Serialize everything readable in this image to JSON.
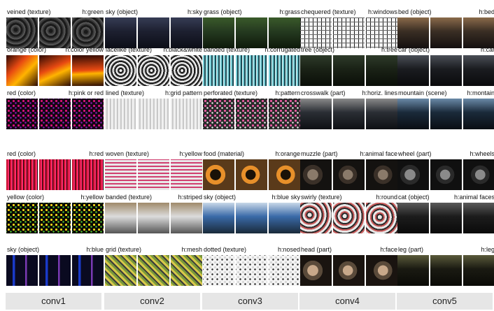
{
  "columns": [
    "conv1",
    "conv2",
    "conv3",
    "conv4",
    "conv5"
  ],
  "cells": [
    [
      {
        "concept": "veined (texture)",
        "hint": "h:green",
        "palette": [
          "#1a1a1a",
          "#3a3a3a",
          "#555555"
        ],
        "pattern": "swirl"
      },
      {
        "concept": "orange (color)",
        "hint": "h:color yellow",
        "palette": [
          "#e84a12",
          "#ffb400",
          "#2b0a04"
        ],
        "pattern": "warm"
      },
      {
        "concept": "red (color)",
        "hint": "h:pink or red",
        "palette": [
          "#d6127a",
          "#7a1aa6",
          "#140614"
        ],
        "pattern": "dots"
      },
      {
        "concept": "red (color)",
        "hint": "h:red",
        "palette": [
          "#c8102e",
          "#ff2d6e",
          "#1a0508"
        ],
        "pattern": "stripes-v"
      },
      {
        "concept": "yellow (color)",
        "hint": "h:yellow",
        "palette": [
          "#f2d21a",
          "#48b02a",
          "#0a0a05"
        ],
        "pattern": "dots"
      },
      {
        "concept": "sky (object)",
        "hint": "h:blue",
        "palette": [
          "#1a3ac8",
          "#7a3ab4",
          "#0a0a20"
        ],
        "pattern": "neon"
      }
    ],
    [
      {
        "concept": "sky (object)",
        "hint": "h:sky",
        "palette": [
          "#1d2030",
          "#363c55",
          "#0c0e18"
        ],
        "pattern": "photo"
      },
      {
        "concept": "lacelike (texture)",
        "hint": "h:black&white",
        "palette": [
          "#f0f0f0",
          "#1a1a1a",
          "#888888"
        ],
        "pattern": "lace"
      },
      {
        "concept": "lined (texture)",
        "hint": "h:grid pattern",
        "palette": [
          "#ececec",
          "#c8c8c8",
          "#f8f8f8"
        ],
        "pattern": "stripes-v"
      },
      {
        "concept": "woven (texture)",
        "hint": "h:yellow",
        "palette": [
          "#e8e8e8",
          "#d04070",
          "#2a2a2a"
        ],
        "pattern": "weave"
      },
      {
        "concept": "banded (texture)",
        "hint": "h:striped",
        "palette": [
          "#dcdcdc",
          "#a08a6a",
          "#555555"
        ],
        "pattern": "photo"
      },
      {
        "concept": "grid (texture)",
        "hint": "h:mesh",
        "palette": [
          "#d8c84a",
          "#7a9a3a",
          "#3a3a3a"
        ],
        "pattern": "diag"
      }
    ],
    [
      {
        "concept": "grass (object)",
        "hint": "h:grass",
        "palette": [
          "#253a20",
          "#3a5a2a",
          "#0e1a0a"
        ],
        "pattern": "photo"
      },
      {
        "concept": "banded (texture)",
        "hint": "h:corrugated",
        "palette": [
          "#7ad0d8",
          "#1a4a54",
          "#e0f4f6"
        ],
        "pattern": "stripes-v"
      },
      {
        "concept": "perforated (texture)",
        "hint": "h:pattern",
        "palette": [
          "#e85aa0",
          "#d8d8d8",
          "#2a2a2a"
        ],
        "pattern": "dots"
      },
      {
        "concept": "food (material)",
        "hint": "h:orange",
        "palette": [
          "#e8902a",
          "#1a1208",
          "#5a3a1a"
        ],
        "pattern": "blobs"
      },
      {
        "concept": "sky (object)",
        "hint": "h:blue sky",
        "palette": [
          "#3a6aa8",
          "#c8d8e8",
          "#1a2a3a"
        ],
        "pattern": "photo"
      },
      {
        "concept": "dotted (texture)",
        "hint": "h:nosed",
        "palette": [
          "#d8d8d8",
          "#3a3a3a",
          "#f4f4f4"
        ],
        "pattern": "dots"
      }
    ],
    [
      {
        "concept": "chequered (texture)",
        "hint": "h:windows",
        "palette": [
          "#f4f4f4",
          "#1a1a1a",
          "#6a6a6a"
        ],
        "pattern": "grid"
      },
      {
        "concept": "tree (object)",
        "hint": "h:tree",
        "palette": [
          "#1a2216",
          "#2e3a2a",
          "#0a0e08"
        ],
        "pattern": "photo"
      },
      {
        "concept": "crosswalk (part)",
        "hint": "h:horiz. lines",
        "palette": [
          "#2a2e34",
          "#8a8a8a",
          "#0e1014"
        ],
        "pattern": "photo"
      },
      {
        "concept": "muzzle (part)",
        "hint": "h:animal face",
        "palette": [
          "#3a3028",
          "#8a7a6a",
          "#141210"
        ],
        "pattern": "blobs"
      },
      {
        "concept": "swirly (texture)",
        "hint": "h:round",
        "palette": [
          "#e8e8e8",
          "#2a2a2a",
          "#c85a5a"
        ],
        "pattern": "swirl"
      },
      {
        "concept": "head (part)",
        "hint": "h:face",
        "palette": [
          "#5a4a3a",
          "#c8a88a",
          "#1a1410"
        ],
        "pattern": "blobs"
      }
    ],
    [
      {
        "concept": "bed (object)",
        "hint": "h:bed",
        "palette": [
          "#3a2e24",
          "#8a6a4a",
          "#141010"
        ],
        "pattern": "photo"
      },
      {
        "concept": "car (object)",
        "hint": "h:car",
        "palette": [
          "#1a1c20",
          "#4a4e56",
          "#0a0a0c"
        ],
        "pattern": "photo"
      },
      {
        "concept": "mountain (scene)",
        "hint": "h:montain",
        "palette": [
          "#1a2a3a",
          "#6a8aa8",
          "#0a0e14"
        ],
        "pattern": "photo"
      },
      {
        "concept": "wheel (part)",
        "hint": "h:wheels",
        "palette": [
          "#2a2a2a",
          "#8a8a8a",
          "#101010"
        ],
        "pattern": "blobs"
      },
      {
        "concept": "cat (object)",
        "hint": "h:animal faces",
        "palette": [
          "#1c1c1c",
          "#5a5a5a",
          "#0a0a0a"
        ],
        "pattern": "photo"
      },
      {
        "concept": "leg (part)",
        "hint": "h:leg",
        "palette": [
          "#1a1a12",
          "#5a5a3a",
          "#0a0a06"
        ],
        "pattern": "photo"
      }
    ]
  ]
}
